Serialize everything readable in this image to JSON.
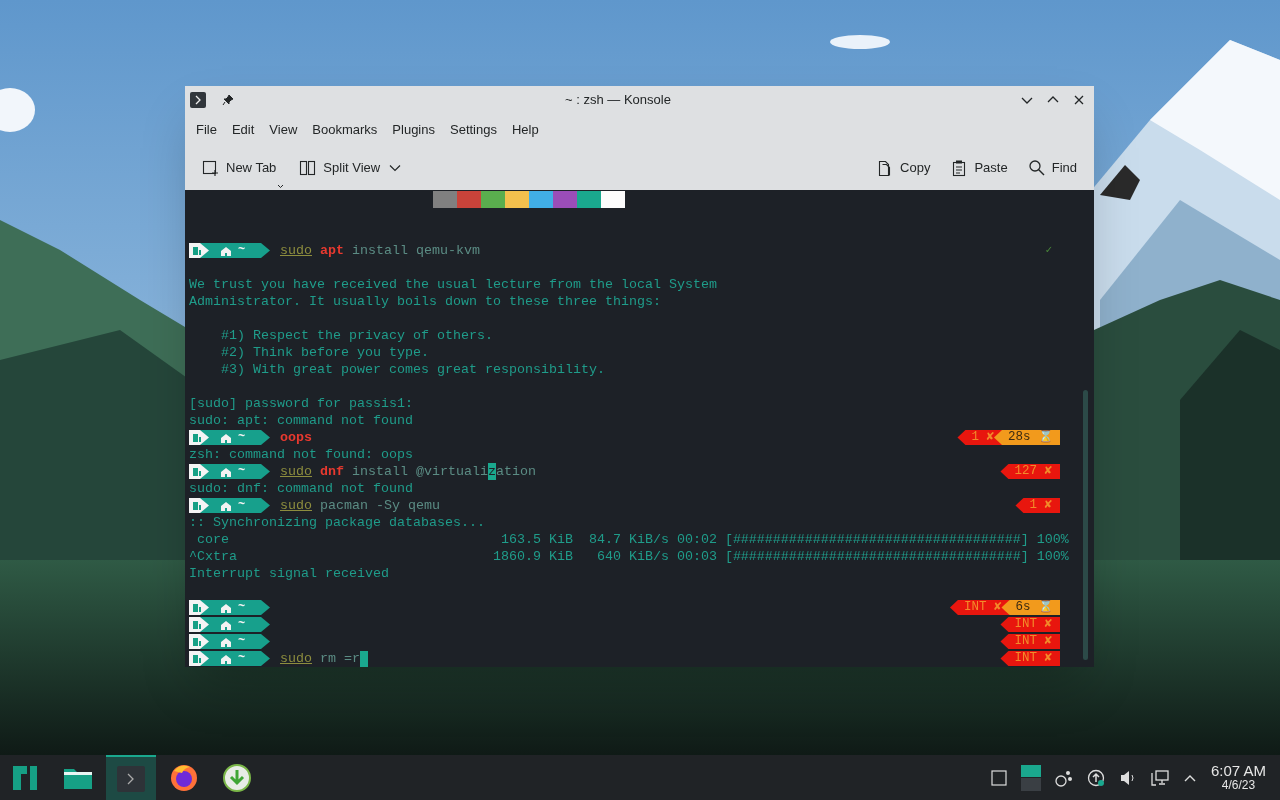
{
  "window": {
    "title": "~ : zsh — Konsole"
  },
  "menu": [
    "File",
    "Edit",
    "View",
    "Bookmarks",
    "Plugins",
    "Settings",
    "Help"
  ],
  "toolbar": {
    "left": [
      {
        "label": "New Tab",
        "kind": "new-tab"
      },
      {
        "label": "Split View",
        "kind": "split-view"
      }
    ],
    "right": [
      {
        "label": "Copy",
        "kind": "copy"
      },
      {
        "label": "Paste",
        "kind": "paste"
      },
      {
        "label": "Find",
        "kind": "find"
      }
    ]
  },
  "terminal": {
    "lines": [
      {
        "kind": "palette",
        "colors": [
          {
            "color": "#808080"
          },
          {
            "color": "#c9433a"
          },
          {
            "color": "#5aae4e"
          },
          {
            "color": "#f3c04d"
          },
          {
            "color": "#41aee6"
          },
          {
            "color": "#9b4db8"
          },
          {
            "color": "#1aa88e"
          },
          {
            "color": "#fcfcfc"
          }
        ]
      },
      {
        "kind": "blank"
      },
      {
        "kind": "blank"
      },
      {
        "kind": "prompt",
        "dir": "~",
        "cursor": false,
        "command": [
          {
            "text": "sudo",
            "kind": "sudo"
          },
          {
            "text": " apt",
            "kind": "error"
          },
          {
            "text": " install qemu-kvm",
            "kind": "plain"
          }
        ],
        "status": [
          {
            "text": "✓",
            "kind": "ok"
          }
        ]
      },
      {
        "kind": "blank"
      },
      {
        "kind": "output",
        "text": "We trust you have received the usual lecture from the local System"
      },
      {
        "kind": "output",
        "text": "Administrator. It usually boils down to these three things:"
      },
      {
        "kind": "blank"
      },
      {
        "kind": "output",
        "text": "    #1) Respect the privacy of others."
      },
      {
        "kind": "output",
        "text": "    #2) Think before you type."
      },
      {
        "kind": "output",
        "text": "    #3) With great power comes great responsibility."
      },
      {
        "kind": "blank"
      },
      {
        "kind": "output",
        "text": "[sudo] password for passis1:"
      },
      {
        "kind": "output",
        "text": "sudo: apt: command not found"
      },
      {
        "kind": "prompt",
        "dir": "~",
        "cursor": false,
        "command": [
          {
            "text": "oops",
            "kind": "error"
          }
        ],
        "status": [
          {
            "text": "1 ✘",
            "kind": "error"
          },
          {
            "text": "28s ⌛",
            "kind": "duration"
          }
        ]
      },
      {
        "kind": "output",
        "text": "zsh: command not found: oops"
      },
      {
        "kind": "prompt",
        "dir": "~",
        "cursor": false,
        "command": [
          {
            "text": "sudo",
            "kind": "sudo"
          },
          {
            "text": " dnf",
            "kind": "error"
          },
          {
            "text": " install @virtuali",
            "kind": "plain"
          },
          {
            "text": "z",
            "kind": "highlight"
          },
          {
            "text": "ation",
            "kind": "plain"
          }
        ],
        "status": [
          {
            "text": "127 ✘",
            "kind": "error"
          }
        ]
      },
      {
        "kind": "output",
        "text": "sudo: dnf: command not found"
      },
      {
        "kind": "prompt",
        "dir": "~",
        "cursor": false,
        "command": [
          {
            "text": "sudo",
            "kind": "sudo"
          },
          {
            "text": " pacman -Sy qemu",
            "kind": "plain"
          }
        ],
        "status": [
          {
            "text": "1 ✘",
            "kind": "error"
          }
        ]
      },
      {
        "kind": "output",
        "text": ":: Synchronizing package databases..."
      },
      {
        "kind": "output",
        "text": " core                                  163.5 KiB  84.7 KiB/s 00:02 [####################################] 100%"
      },
      {
        "kind": "output",
        "text": "^Cxtra                                1860.9 KiB   640 KiB/s 00:03 [####################################] 100%"
      },
      {
        "kind": "output",
        "text": "Interrupt signal received"
      },
      {
        "kind": "blank"
      },
      {
        "kind": "prompt",
        "dir": "~",
        "cursor": false,
        "status": [
          {
            "text": "INT ✘",
            "kind": "error"
          },
          {
            "text": "6s ⌛",
            "kind": "duration"
          }
        ]
      },
      {
        "kind": "prompt",
        "dir": "~",
        "cursor": false,
        "status": [
          {
            "text": "INT ✘",
            "kind": "error"
          }
        ]
      },
      {
        "kind": "prompt",
        "dir": "~",
        "cursor": false,
        "status": [
          {
            "text": "INT ✘",
            "kind": "error"
          }
        ]
      },
      {
        "kind": "prompt",
        "dir": "~",
        "cursor": true,
        "command": [
          {
            "text": "sudo",
            "kind": "sudo"
          },
          {
            "text": " rm =r",
            "kind": "plain"
          }
        ],
        "status": [
          {
            "text": "INT ✘",
            "kind": "error"
          }
        ]
      }
    ]
  },
  "taskbar": {
    "apps": [
      {
        "kind": "launcher",
        "selected": false
      },
      {
        "kind": "files",
        "selected": false
      },
      {
        "kind": "terminal",
        "selected": true
      },
      {
        "kind": "browser",
        "selected": false
      },
      {
        "kind": "download",
        "selected": false
      }
    ],
    "clock": {
      "time": "6:07 AM",
      "date": "4/6/23"
    }
  }
}
